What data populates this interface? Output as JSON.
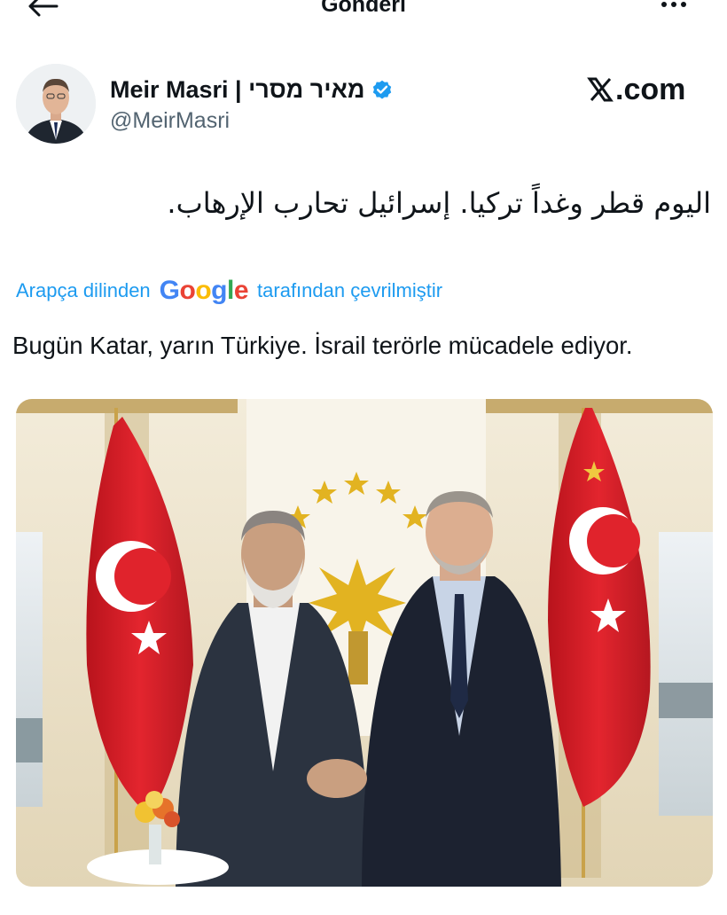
{
  "header": {
    "title": "Gönderi",
    "back_icon": "arrow-left-icon",
    "more_icon": "ellipsis-icon"
  },
  "author": {
    "name": "Meir Masri | מאיר מסרי",
    "handle": "@MeirMasri",
    "verified": true,
    "verified_color": "#1d9bf0"
  },
  "watermark": "X.com",
  "tweet": {
    "text": "اليوم قطر وغداً تركيا. إسرائيل تحارب الإرهاب.",
    "translation_prefix": "Arapça dilinden",
    "translation_provider": "Google",
    "translation_suffix": "tarafından çevrilmiştir",
    "translated_text": "Bugün Katar, yarın Türkiye. İsrail terörle mücadele ediyor."
  },
  "colors": {
    "accent": "#1d9bf0",
    "text": "#0f1419",
    "secondary": "#536471",
    "flag_red": "#d8212a"
  }
}
